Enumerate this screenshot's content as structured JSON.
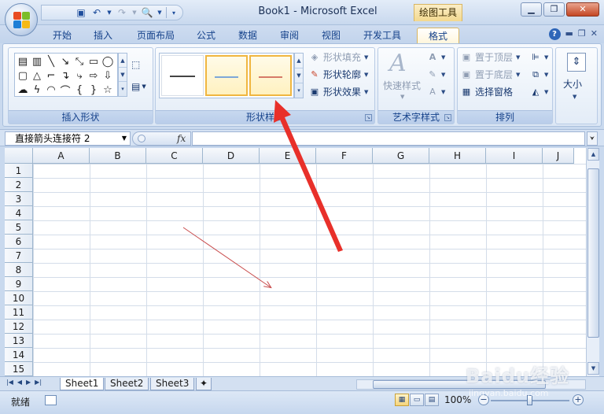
{
  "window": {
    "title_doc": "Book1",
    "title_sep": "-",
    "title_app": "Microsoft Excel",
    "context_tab": "绘图工具"
  },
  "tabs": [
    "开始",
    "插入",
    "页面布局",
    "公式",
    "数据",
    "审阅",
    "视图",
    "开发工具",
    "格式"
  ],
  "active_tab": "格式",
  "ribbon": {
    "insert_shapes": {
      "label": "插入形状"
    },
    "shape_styles": {
      "label": "形状样式",
      "fill": "形状填充",
      "outline": "形状轮廓",
      "effects": "形状效果",
      "swatch_colors": [
        "#444444",
        "#7ea7d8",
        "#d67a68"
      ]
    },
    "wordart": {
      "label": "艺术字样式",
      "quick_styles": "快速样式"
    },
    "arrange": {
      "label": "排列",
      "bring_front": "置于顶层",
      "send_back": "置于底层",
      "selection_pane": "选择窗格"
    },
    "size": {
      "label": "大小"
    }
  },
  "formula_bar": {
    "name_box": "直接箭头连接符 2",
    "fx": "fx",
    "value": ""
  },
  "columns": [
    "A",
    "B",
    "C",
    "D",
    "E",
    "F",
    "G",
    "H",
    "I",
    "J"
  ],
  "rows": [
    "1",
    "2",
    "3",
    "4",
    "5",
    "6",
    "7",
    "8",
    "9",
    "10",
    "11",
    "12",
    "13",
    "14",
    "15"
  ],
  "sheets": [
    "Sheet1",
    "Sheet2",
    "Sheet3"
  ],
  "active_sheet": "Sheet1",
  "status": {
    "ready": "就绪",
    "zoom": "100%",
    "zoom_minus": "−",
    "zoom_plus": "+"
  },
  "colors": {
    "annotation_arrow": "#e8302a",
    "connector_line": "#c84b4b",
    "accent_tab": "#f3d98f"
  },
  "watermark": {
    "brand": "Baidu经验",
    "url": "jingyan.baidu.com"
  }
}
